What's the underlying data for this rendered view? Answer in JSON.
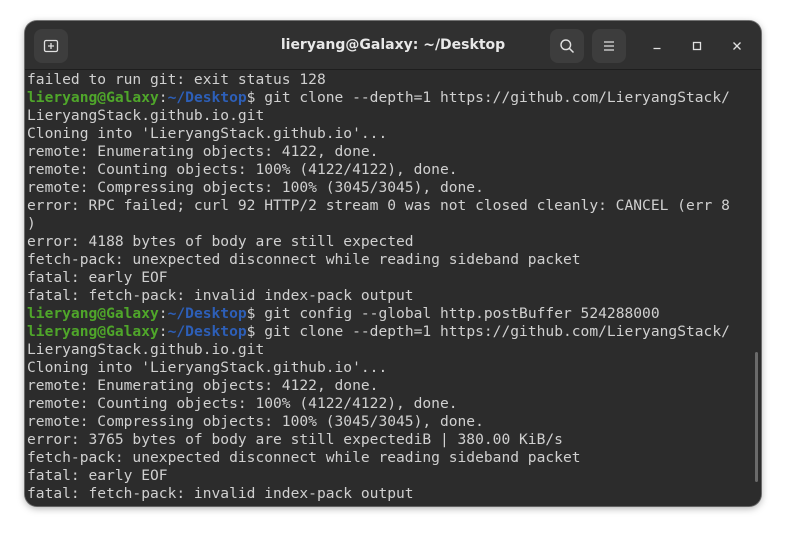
{
  "window": {
    "title": "lieryang@Galaxy: ~/Desktop"
  },
  "titlebar": {
    "new_tab_icon": "new-tab-icon",
    "search_icon": "search-icon",
    "menu_icon": "hamburger-menu-icon",
    "minimize_icon": "minimize-icon",
    "maximize_icon": "maximize-icon",
    "close_icon": "close-icon"
  },
  "colors": {
    "prompt_user": "#4fa62a",
    "prompt_path": "#2d5fb8",
    "text": "#d0d0d0",
    "background": "#2c2c2c"
  },
  "terminal": {
    "lines": [
      {
        "text": "failed to run git: exit status 128"
      },
      {
        "user": "lieryang@Galaxy",
        "sep": ":",
        "path": "~/Desktop",
        "cmd": "$ git clone --depth=1 https://github.com/LieryangStack/"
      },
      {
        "text": "LieryangStack.github.io.git"
      },
      {
        "text": "Cloning into 'LieryangStack.github.io'..."
      },
      {
        "text": "remote: Enumerating objects: 4122, done."
      },
      {
        "text": "remote: Counting objects: 100% (4122/4122), done."
      },
      {
        "text": "remote: Compressing objects: 100% (3045/3045), done."
      },
      {
        "text": "error: RPC failed; curl 92 HTTP/2 stream 0 was not closed cleanly: CANCEL (err 8"
      },
      {
        "text": ")"
      },
      {
        "text": "error: 4188 bytes of body are still expected"
      },
      {
        "text": "fetch-pack: unexpected disconnect while reading sideband packet"
      },
      {
        "text": "fatal: early EOF"
      },
      {
        "text": "fatal: fetch-pack: invalid index-pack output"
      },
      {
        "user": "lieryang@Galaxy",
        "sep": ":",
        "path": "~/Desktop",
        "cmd": "$ git config --global http.postBuffer 524288000"
      },
      {
        "user": "lieryang@Galaxy",
        "sep": ":",
        "path": "~/Desktop",
        "cmd": "$ git clone --depth=1 https://github.com/LieryangStack/"
      },
      {
        "text": "LieryangStack.github.io.git"
      },
      {
        "text": "Cloning into 'LieryangStack.github.io'..."
      },
      {
        "text": "remote: Enumerating objects: 4122, done."
      },
      {
        "text": "remote: Counting objects: 100% (4122/4122), done."
      },
      {
        "text": "remote: Compressing objects: 100% (3045/3045), done."
      },
      {
        "text": "error: 3765 bytes of body are still expectediB | 380.00 KiB/s"
      },
      {
        "text": "fetch-pack: unexpected disconnect while reading sideband packet"
      },
      {
        "text": "fatal: early EOF"
      },
      {
        "text": "fatal: fetch-pack: invalid index-pack output"
      }
    ]
  }
}
